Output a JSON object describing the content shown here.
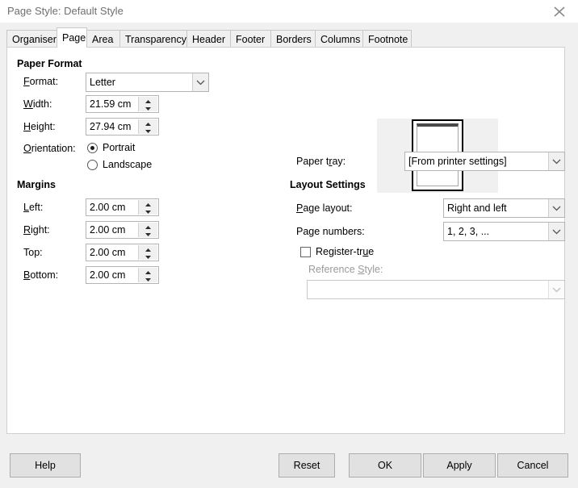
{
  "window": {
    "title": "Page Style: Default Style",
    "close_icon": "close-icon"
  },
  "tabs": [
    {
      "label": "Organiser",
      "active": false
    },
    {
      "label": "Page",
      "active": true
    },
    {
      "label": "Area",
      "active": false
    },
    {
      "label": "Transparency",
      "active": false
    },
    {
      "label": "Header",
      "active": false
    },
    {
      "label": "Footer",
      "active": false
    },
    {
      "label": "Borders",
      "active": false
    },
    {
      "label": "Columns",
      "active": false
    },
    {
      "label": "Footnote",
      "active": false
    }
  ],
  "paper_format": {
    "group_label": "Paper Format",
    "format_label": "Format:",
    "format_value": "Letter",
    "width_label": "Width:",
    "width_value": "21.59 cm",
    "height_label": "Height:",
    "height_value": "27.94 cm",
    "orientation_label": "Orientation:",
    "orientation_portrait": "Portrait",
    "orientation_landscape": "Landscape",
    "orientation_selected": "Portrait"
  },
  "margins": {
    "group_label": "Margins",
    "left_label": "Left:",
    "left_value": "2.00 cm",
    "right_label": "Right:",
    "right_value": "2.00 cm",
    "top_label": "Top:",
    "top_value": "2.00 cm",
    "bottom_label": "Bottom:",
    "bottom_value": "2.00 cm"
  },
  "paper_tray": {
    "label": "Paper tray:",
    "value": "[From printer settings]"
  },
  "layout_settings": {
    "group_label": "Layout Settings",
    "page_layout_label": "Page layout:",
    "page_layout_value": "Right and left",
    "page_numbers_label": "Page numbers:",
    "page_numbers_value": "1, 2, 3, ...",
    "register_true_label": "Register-true",
    "register_true_checked": false,
    "reference_style_label": "Reference Style:",
    "reference_style_value": ""
  },
  "footer": {
    "help": "Help",
    "reset": "Reset",
    "ok": "OK",
    "apply": "Apply",
    "cancel": "Cancel"
  },
  "colors": {
    "dialog_bg": "#f0f0f0",
    "panel_bg": "#ffffff",
    "border": "#b4b4b4",
    "title_text": "#6f6f6f",
    "disabled_text": "#9a9a9a",
    "button_bg": "#e1e1e1"
  }
}
